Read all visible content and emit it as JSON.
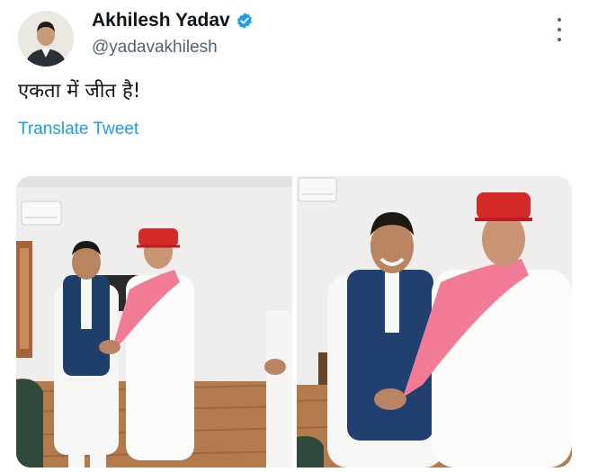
{
  "author": {
    "name": "Akhilesh Yadav",
    "handle": "@yadavakhilesh",
    "verified": true,
    "avatar_icon": "user-avatar"
  },
  "tweet": {
    "text": "एकता में जीत है!",
    "translate_label": "Translate Tweet"
  },
  "media": {
    "count": 2,
    "items": [
      {
        "icon": "photo-two-men-greeting"
      },
      {
        "icon": "photo-two-men-embracing"
      }
    ]
  },
  "colors": {
    "link": "#1d9bf0",
    "secondary_text": "#536471",
    "verified_badge": "#1d9bf0"
  }
}
